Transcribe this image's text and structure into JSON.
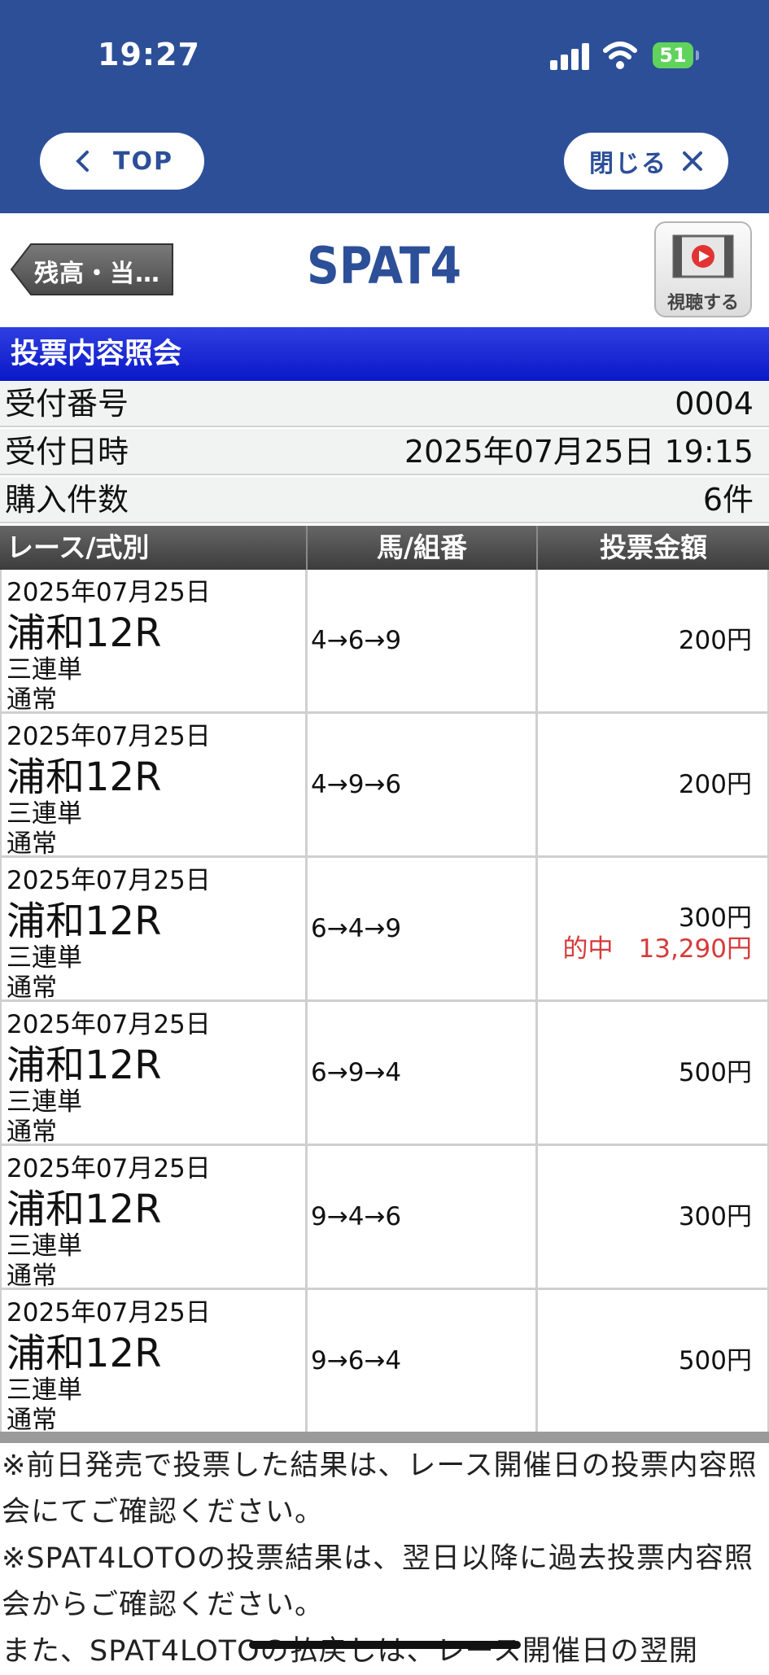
{
  "status_bar": {
    "time": "19:27",
    "battery": "51"
  },
  "nav": {
    "top_label": "TOP",
    "close_label": "閉じる"
  },
  "header": {
    "back_label": "残高・当…",
    "logo_text": "SPAT4",
    "watch_label": "視聴する"
  },
  "section_title": "投票内容照会",
  "info": [
    {
      "label": "受付番号",
      "value": "0004"
    },
    {
      "label": "受付日時",
      "value": "2025年07月25日 19:15"
    },
    {
      "label": "購入件数",
      "value": "6件"
    }
  ],
  "table": {
    "headers": [
      "レース/式別",
      "馬/組番",
      "投票金額"
    ],
    "rows": [
      {
        "date": "2025年07月25日",
        "race": "浦和12R",
        "bet_type": "三連単",
        "kind": "通常",
        "combo": "4→6→9",
        "amount": "200円"
      },
      {
        "date": "2025年07月25日",
        "race": "浦和12R",
        "bet_type": "三連単",
        "kind": "通常",
        "combo": "4→9→6",
        "amount": "200円"
      },
      {
        "date": "2025年07月25日",
        "race": "浦和12R",
        "bet_type": "三連単",
        "kind": "通常",
        "combo": "6→4→9",
        "amount": "300円",
        "win": "的中　13,290円"
      },
      {
        "date": "2025年07月25日",
        "race": "浦和12R",
        "bet_type": "三連単",
        "kind": "通常",
        "combo": "6→9→4",
        "amount": "500円"
      },
      {
        "date": "2025年07月25日",
        "race": "浦和12R",
        "bet_type": "三連単",
        "kind": "通常",
        "combo": "9→4→6",
        "amount": "300円"
      },
      {
        "date": "2025年07月25日",
        "race": "浦和12R",
        "bet_type": "三連単",
        "kind": "通常",
        "combo": "9→6→4",
        "amount": "500円"
      }
    ]
  },
  "notes": [
    "※前日発売で投票した結果は、レース開催日の投票内容照会にてご確認ください。",
    "※SPAT4LOTOの投票結果は、翌日以降に過去投票内容照会からご確認ください。",
    "また、SPAT4LOTOの払戻しは、レース開催日の翌開"
  ],
  "colors": {
    "header_blue": "#2c4f98",
    "section_blue": "#0a18c8",
    "win_red": "#d63a3a"
  }
}
